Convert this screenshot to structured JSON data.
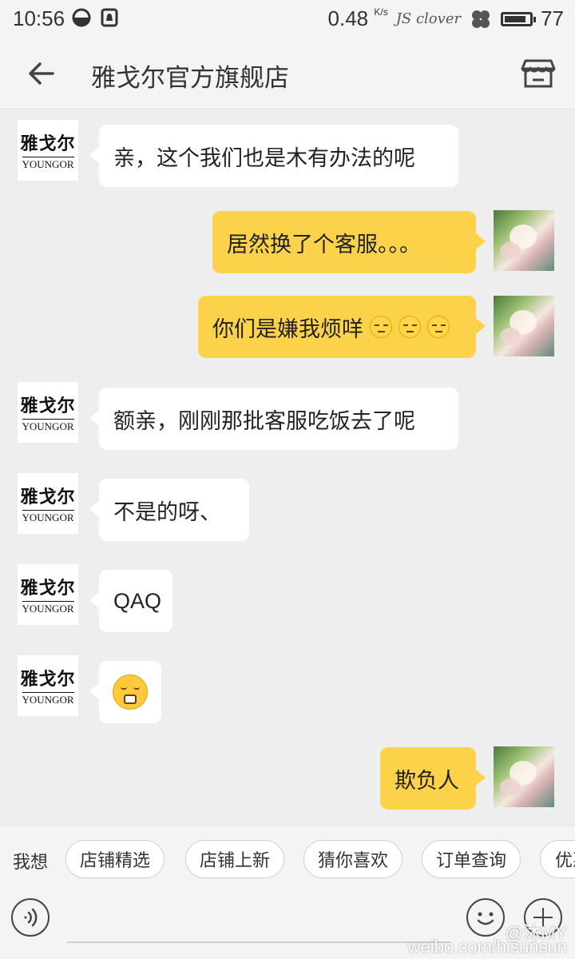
{
  "status_bar": {
    "time": "10:56",
    "speed": "0.48",
    "speed_unit": "K/s",
    "carrier": "JS clover",
    "battery": "77"
  },
  "header": {
    "title": "雅戈尔官方旗舰店",
    "back_icon": "back-arrow-icon",
    "store_icon": "storefront-icon"
  },
  "brand_avatar": {
    "cn": "雅戈尔",
    "en": "YOUNGOR"
  },
  "messages": [
    {
      "side": "in",
      "text": "亲，这个我们也是木有办法的呢"
    },
    {
      "side": "out",
      "text": "居然换了个客服。。。"
    },
    {
      "side": "out",
      "text": "你们是嫌我烦咩",
      "emoji_count": 3
    },
    {
      "side": "in",
      "text": "额亲，刚刚那批客服吃饭去了呢"
    },
    {
      "side": "in",
      "text": "不是的呀、"
    },
    {
      "side": "in",
      "text": "QAQ"
    },
    {
      "side": "in",
      "emoji": "sticker-face"
    },
    {
      "side": "out",
      "text": "欺负人"
    }
  ],
  "quick_bar": {
    "label": "我想",
    "chips": [
      "店铺精选",
      "店铺上新",
      "猜你喜欢",
      "订单查询",
      "优惠"
    ]
  },
  "input_bar": {
    "voice_icon": "voice-icon",
    "emoji_icon": "smiley-icon",
    "plus_icon": "plus-icon"
  },
  "watermark": {
    "line1": "@沐MY",
    "line2": "weibo.com/hisunsun"
  },
  "colors": {
    "outgoing_bubble": "#fcd24b",
    "incoming_bubble": "#ffffff",
    "background": "#eeeeee"
  }
}
